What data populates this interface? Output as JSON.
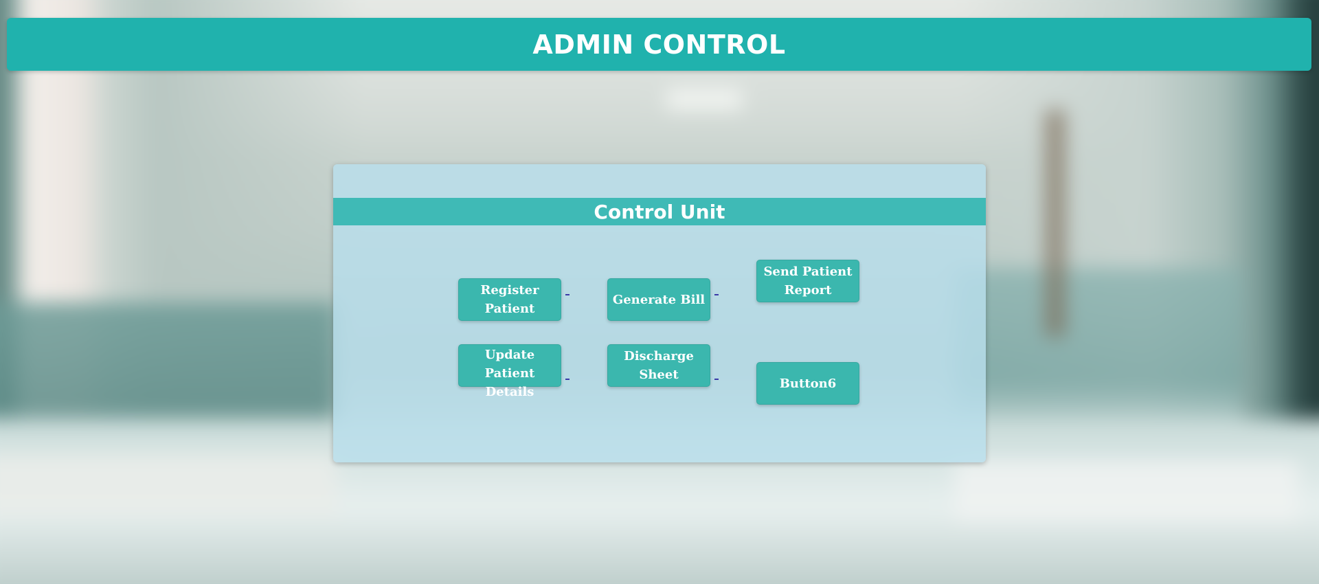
{
  "header": {
    "title": "ADMIN CONTROL"
  },
  "panel": {
    "title": "Control Unit",
    "buttons": [
      {
        "label": "Register Patient"
      },
      {
        "label": "Generate Bill"
      },
      {
        "label": "Send Patient Report"
      },
      {
        "label": "Update Patient Details"
      },
      {
        "label": "Discharge Sheet"
      },
      {
        "label": "Button6"
      }
    ]
  },
  "colors": {
    "header_bg": "#20b2ad",
    "panel_bg": "#b8deeb",
    "panel_title_bg": "#20b2aa",
    "button_bg": "#3bb7ae",
    "text": "#ffffff",
    "link_mark": "#3a3aa8"
  }
}
